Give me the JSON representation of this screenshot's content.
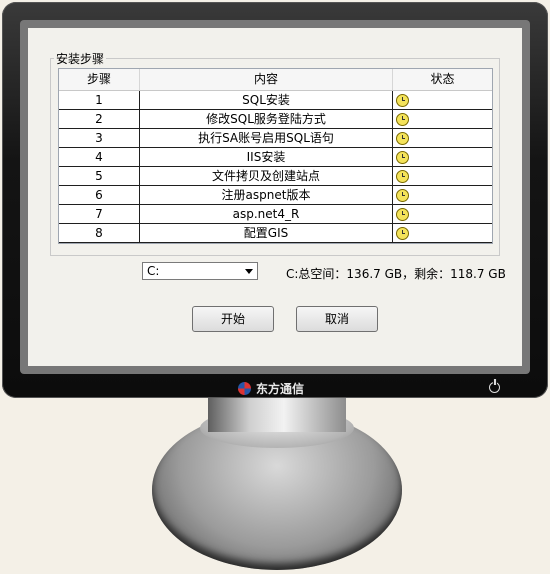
{
  "group_title": "安装步骤",
  "columns": [
    "步骤",
    "内容",
    "状态"
  ],
  "steps": [
    {
      "num": "1",
      "content": "SQL安装",
      "status": "pending-clock-icon"
    },
    {
      "num": "2",
      "content": "修改SQL服务登陆方式",
      "status": "pending-clock-icon"
    },
    {
      "num": "3",
      "content": "执行SA账号启用SQL语句",
      "status": "pending-clock-icon"
    },
    {
      "num": "4",
      "content": "IIS安装",
      "status": "pending-clock-icon"
    },
    {
      "num": "5",
      "content": "文件拷贝及创建站点",
      "status": "pending-clock-icon"
    },
    {
      "num": "6",
      "content": "注册aspnet版本",
      "status": "pending-clock-icon"
    },
    {
      "num": "7",
      "content": "asp.net4_R",
      "status": "pending-clock-icon"
    },
    {
      "num": "8",
      "content": "配置GIS",
      "status": "pending-clock-icon"
    }
  ],
  "drive_select": {
    "value": "C:"
  },
  "disk_space": "C:总空间：136.7 GB，剩余：118.7 GB",
  "buttons": {
    "start": "开始",
    "cancel": "取消"
  },
  "brand": {
    "name": "东方通信",
    "colors": [
      "#d33333",
      "#2556a8"
    ]
  }
}
